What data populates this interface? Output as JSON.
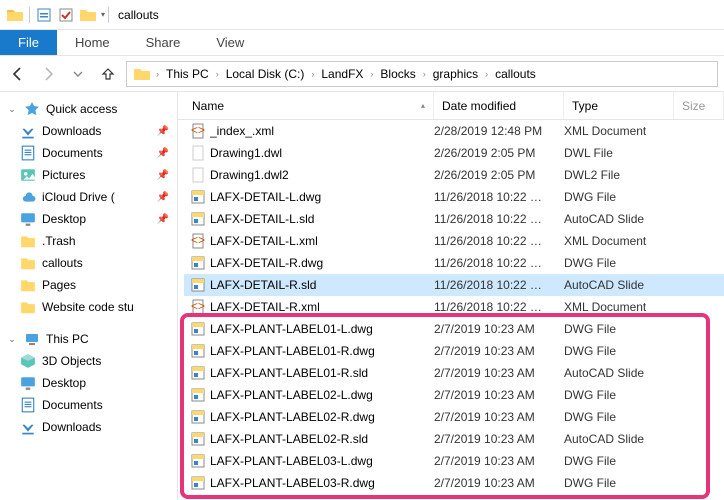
{
  "window": {
    "title": "callouts"
  },
  "ribbon": {
    "file": "File",
    "tabs": [
      "Home",
      "Share",
      "View"
    ]
  },
  "breadcrumb": [
    "This PC",
    "Local Disk (C:)",
    "LandFX",
    "Blocks",
    "graphics",
    "callouts"
  ],
  "columns": {
    "name": "Name",
    "date": "Date modified",
    "type": "Type",
    "size": "Size"
  },
  "sidebar": {
    "quick": "Quick access",
    "items": [
      {
        "label": "Downloads",
        "icon": "download",
        "pin": true
      },
      {
        "label": "Documents",
        "icon": "doc",
        "pin": true
      },
      {
        "label": "Pictures",
        "icon": "pic",
        "pin": true
      },
      {
        "label": "iCloud Drive (",
        "icon": "cloud",
        "pin": true
      },
      {
        "label": "Desktop",
        "icon": "desktop",
        "pin": true
      },
      {
        "label": ".Trash",
        "icon": "folder",
        "pin": false
      },
      {
        "label": "callouts",
        "icon": "folder",
        "pin": false
      },
      {
        "label": "Pages",
        "icon": "folder",
        "pin": false
      },
      {
        "label": "Website code stu",
        "icon": "folder",
        "pin": false
      }
    ],
    "thispc": "This PC",
    "pc": [
      {
        "label": "3D Objects",
        "icon": "3d"
      },
      {
        "label": "Desktop",
        "icon": "desktop"
      },
      {
        "label": "Documents",
        "icon": "doc"
      },
      {
        "label": "Downloads",
        "icon": "download"
      }
    ]
  },
  "files": [
    {
      "name": "_index_.xml",
      "date": "2/28/2019 12:48 PM",
      "type": "XML Document",
      "icon": "xml",
      "sel": false,
      "hi": false
    },
    {
      "name": "Drawing1.dwl",
      "date": "2/26/2019 2:05 PM",
      "type": "DWL File",
      "icon": "blank",
      "sel": false,
      "hi": false
    },
    {
      "name": "Drawing1.dwl2",
      "date": "2/26/2019 2:05 PM",
      "type": "DWL2 File",
      "icon": "blank",
      "sel": false,
      "hi": false
    },
    {
      "name": "LAFX-DETAIL-L.dwg",
      "date": "11/26/2018 10:22 …",
      "type": "DWG File",
      "icon": "dwg",
      "sel": false,
      "hi": false
    },
    {
      "name": "LAFX-DETAIL-L.sld",
      "date": "11/26/2018 10:22 …",
      "type": "AutoCAD Slide",
      "icon": "dwg",
      "sel": false,
      "hi": false
    },
    {
      "name": "LAFX-DETAIL-L.xml",
      "date": "11/26/2018 10:22 …",
      "type": "XML Document",
      "icon": "xml",
      "sel": false,
      "hi": false
    },
    {
      "name": "LAFX-DETAIL-R.dwg",
      "date": "11/26/2018 10:22 …",
      "type": "DWG File",
      "icon": "dwg",
      "sel": false,
      "hi": false
    },
    {
      "name": "LAFX-DETAIL-R.sld",
      "date": "11/26/2018 10:22 …",
      "type": "AutoCAD Slide",
      "icon": "dwg",
      "sel": true,
      "hi": false
    },
    {
      "name": "LAFX-DETAIL-R.xml",
      "date": "11/26/2018 10:22 …",
      "type": "XML Document",
      "icon": "xml",
      "sel": false,
      "hi": false
    },
    {
      "name": "LAFX-PLANT-LABEL01-L.dwg",
      "date": "2/7/2019 10:23 AM",
      "type": "DWG File",
      "icon": "dwg",
      "sel": false,
      "hi": true
    },
    {
      "name": "LAFX-PLANT-LABEL01-R.dwg",
      "date": "2/7/2019 10:23 AM",
      "type": "DWG File",
      "icon": "dwg",
      "sel": false,
      "hi": true
    },
    {
      "name": "LAFX-PLANT-LABEL01-R.sld",
      "date": "2/7/2019 10:23 AM",
      "type": "AutoCAD Slide",
      "icon": "dwg",
      "sel": false,
      "hi": true
    },
    {
      "name": "LAFX-PLANT-LABEL02-L.dwg",
      "date": "2/7/2019 10:23 AM",
      "type": "DWG File",
      "icon": "dwg",
      "sel": false,
      "hi": true
    },
    {
      "name": "LAFX-PLANT-LABEL02-R.dwg",
      "date": "2/7/2019 10:23 AM",
      "type": "DWG File",
      "icon": "dwg",
      "sel": false,
      "hi": true
    },
    {
      "name": "LAFX-PLANT-LABEL02-R.sld",
      "date": "2/7/2019 10:23 AM",
      "type": "AutoCAD Slide",
      "icon": "dwg",
      "sel": false,
      "hi": true
    },
    {
      "name": "LAFX-PLANT-LABEL03-L.dwg",
      "date": "2/7/2019 10:23 AM",
      "type": "DWG File",
      "icon": "dwg",
      "sel": false,
      "hi": true
    },
    {
      "name": "LAFX-PLANT-LABEL03-R.dwg",
      "date": "2/7/2019 10:23 AM",
      "type": "DWG File",
      "icon": "dwg",
      "sel": false,
      "hi": true
    }
  ]
}
